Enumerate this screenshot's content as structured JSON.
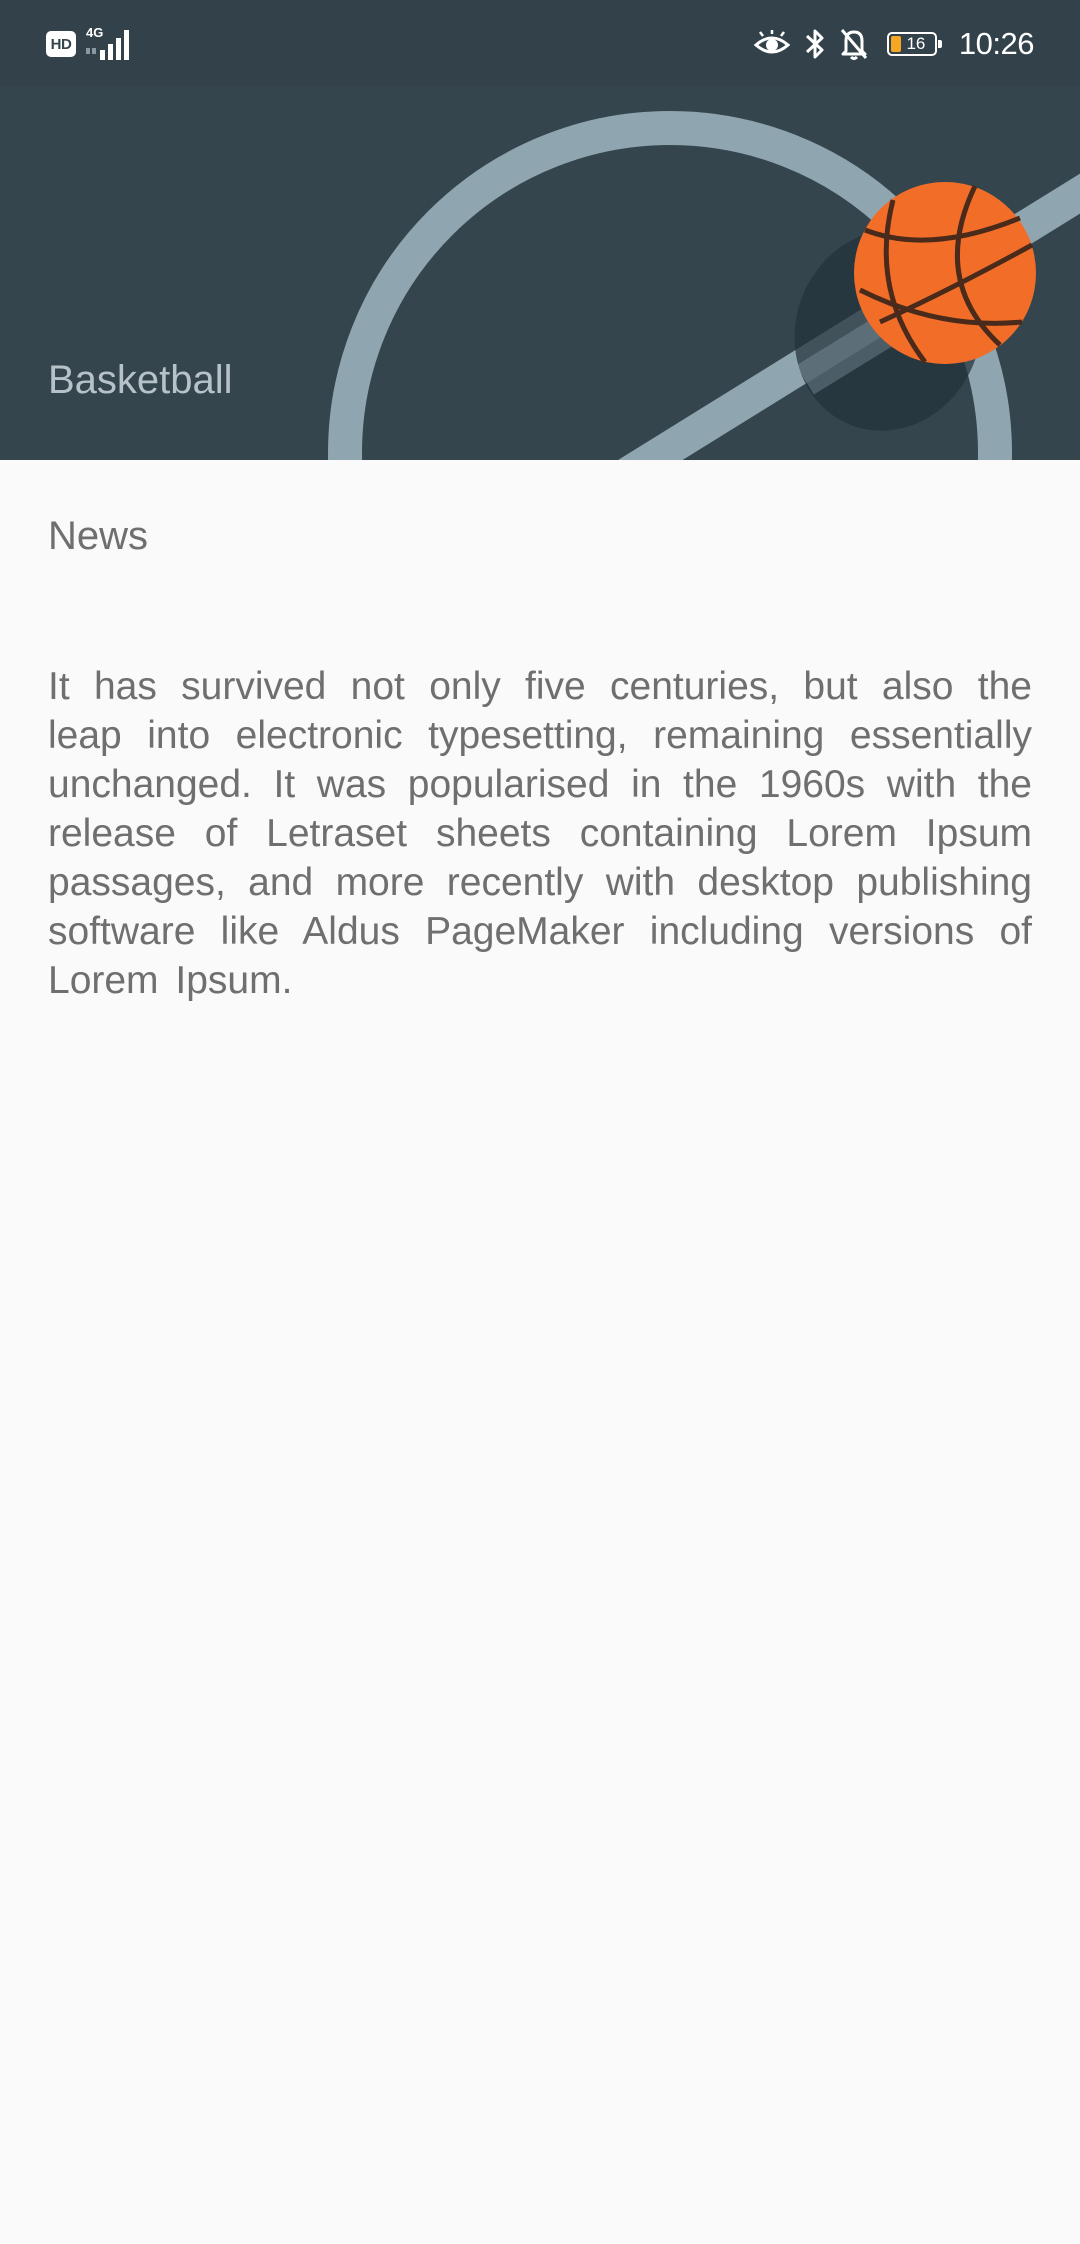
{
  "status_bar": {
    "hd_label": "HD",
    "network_label": "4G",
    "battery_level": "16",
    "time": "10:26",
    "icons": [
      "eye-comfort-icon",
      "bluetooth-icon",
      "notifications-off-icon",
      "battery-icon"
    ]
  },
  "header": {
    "title": "Basketball",
    "background_color": "#34454d",
    "ball_color": "#f26522"
  },
  "content": {
    "section_title": "News",
    "body": "It has survived not only five centuries, but also the leap into electronic typesetting, remaining essentially unchanged. It was popularised in the 1960s with the release of Letraset sheets containing Lorem Ipsum passages, and more recently with desktop publishing software like Aldus PageMaker including versions of Lorem Ipsum."
  }
}
